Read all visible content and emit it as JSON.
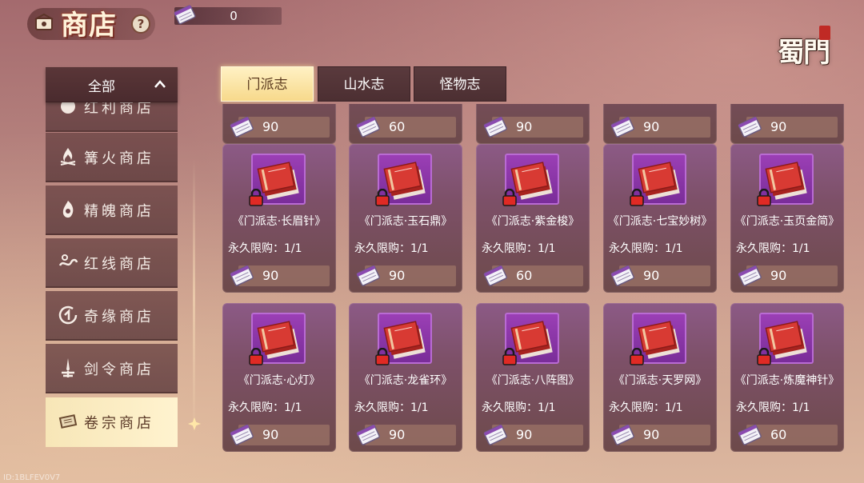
{
  "header": {
    "title": "商店",
    "currency_value": "0",
    "logo_text": "蜀門"
  },
  "sidebar": {
    "filter_label": "全部",
    "items": [
      {
        "label": "红利商店",
        "icon": "gift-icon",
        "active": false
      },
      {
        "label": "篝火商店",
        "icon": "campfire-icon",
        "active": false
      },
      {
        "label": "精魄商店",
        "icon": "soul-icon",
        "active": false
      },
      {
        "label": "红线商店",
        "icon": "red-thread-icon",
        "active": false
      },
      {
        "label": "奇缘商店",
        "icon": "fortune-icon",
        "active": false
      },
      {
        "label": "剑令商店",
        "icon": "sword-icon",
        "active": false
      },
      {
        "label": "卷宗商店",
        "icon": "scroll-icon",
        "active": true
      }
    ]
  },
  "tabs": [
    {
      "label": "门派志",
      "active": true
    },
    {
      "label": "山水志",
      "active": false
    },
    {
      "label": "怪物志",
      "active": false
    }
  ],
  "items_row0": [
    {
      "price": "90"
    },
    {
      "price": "60"
    },
    {
      "price": "90"
    },
    {
      "price": "90"
    },
    {
      "price": "90"
    }
  ],
  "items_row1": [
    {
      "name": "《门派志·长眉针》",
      "limit": "永久限购：1/1",
      "price": "90"
    },
    {
      "name": "《门派志·玉石鼎》",
      "limit": "永久限购：1/1",
      "price": "90"
    },
    {
      "name": "《门派志·紫金梭》",
      "limit": "永久限购：1/1",
      "price": "60"
    },
    {
      "name": "《门派志·七宝妙树》",
      "limit": "永久限购：1/1",
      "price": "90"
    },
    {
      "name": "《门派志·玉页金简》",
      "limit": "永久限购：1/1",
      "price": "90"
    }
  ],
  "items_row2": [
    {
      "name": "《门派志·心灯》",
      "limit": "永久限购：1/1",
      "price": "90"
    },
    {
      "name": "《门派志·龙雀环》",
      "limit": "永久限购：1/1",
      "price": "90"
    },
    {
      "name": "《门派志·八阵图》",
      "limit": "永久限购：1/1",
      "price": "90"
    },
    {
      "name": "《门派志·天罗网》",
      "limit": "永久限购：1/1",
      "price": "90"
    },
    {
      "name": "《门派志·炼魔神针》",
      "limit": "永久限购：1/1",
      "price": "60"
    }
  ],
  "footer": {
    "id_text": "ID:1BLFEV0V7"
  },
  "colors": {
    "tab_active": "#f7d98b",
    "card_top": "#8c5a86",
    "card_bottom": "#6d4a4a",
    "book_red": "#c8302c"
  }
}
